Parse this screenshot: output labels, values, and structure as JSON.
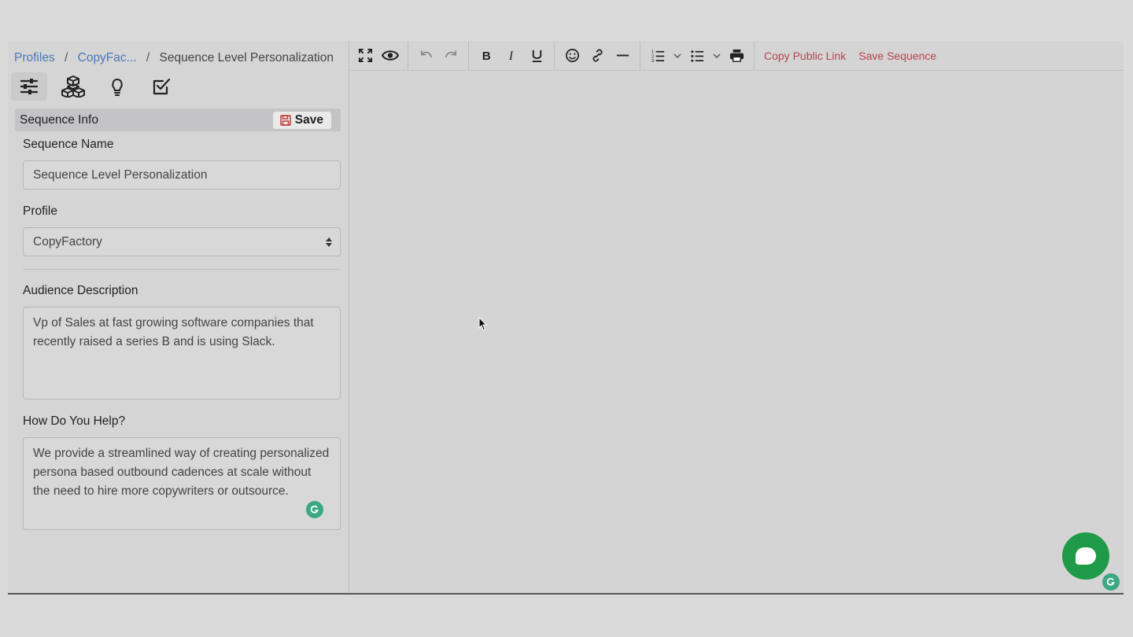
{
  "breadcrumb": {
    "items": [
      "Profiles",
      "CopyFac..."
    ],
    "separator": "/",
    "current": "Sequence Level Personalization"
  },
  "sidebar_icons": [
    "sliders-icon",
    "cubes-icon",
    "lightbulb-icon",
    "checkbox-icon"
  ],
  "section": {
    "title": "Sequence Info",
    "save_label": "Save"
  },
  "form": {
    "sequence_name_label": "Sequence Name",
    "sequence_name_value": "Sequence Level Personalization",
    "profile_label": "Profile",
    "profile_value": "CopyFactory",
    "audience_label": "Audience Description",
    "audience_value": "Vp of Sales at fast growing software companies that recently raised a series B and is using Slack.",
    "help_label": "How Do You Help?",
    "help_value": "We provide a streamlined way of creating personalized persona based outbound cadences at scale without the need to hire more copywriters or outsource."
  },
  "toolbar": {
    "copy_link_label": "Copy Public Link",
    "save_sequence_label": "Save Sequence"
  },
  "colors": {
    "link_blue": "#4a7ab8",
    "action_red": "#b3474d",
    "chat_green": "#1f9a48",
    "grammarly_green": "#3aa882"
  }
}
